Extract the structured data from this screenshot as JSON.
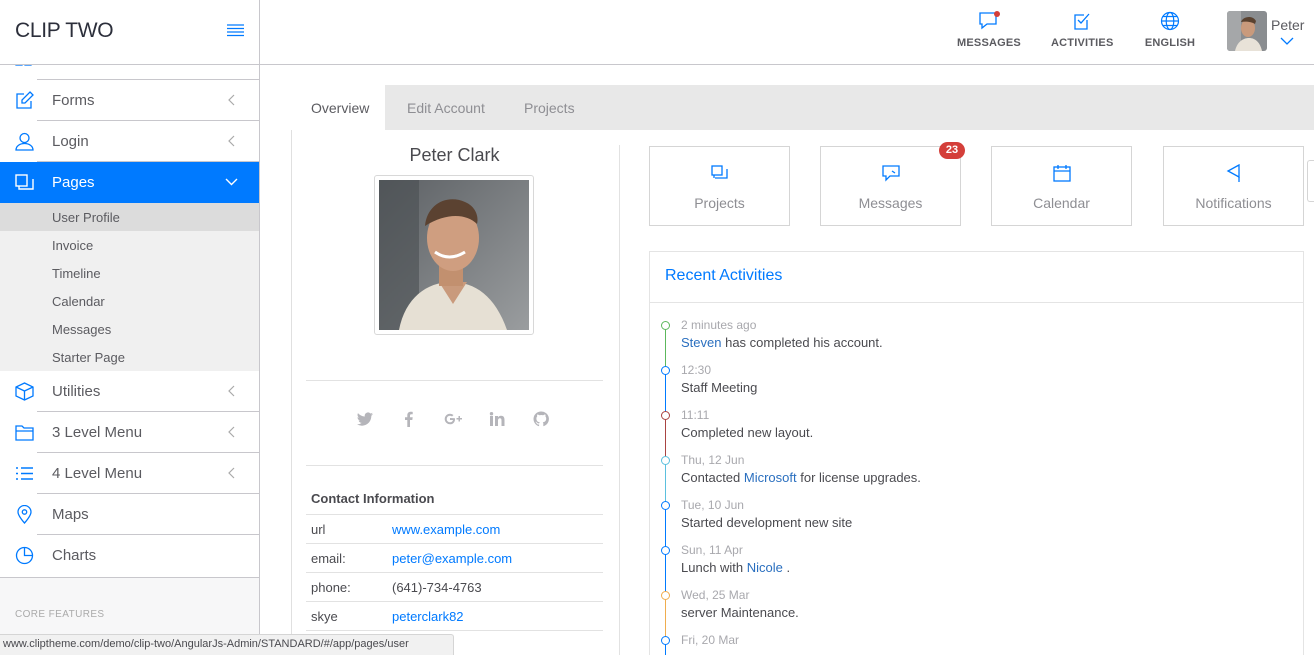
{
  "brand": {
    "name": "CLIP TWO"
  },
  "sidebar": {
    "items": [
      {
        "label": "Forms",
        "icon": "pencil-square-icon"
      },
      {
        "label": "Login",
        "icon": "user-icon"
      },
      {
        "label": "Pages",
        "icon": "copy-icon",
        "active": true
      },
      {
        "label": "Utilities",
        "icon": "cube-icon"
      },
      {
        "label": "3 Level Menu",
        "icon": "folder-icon"
      },
      {
        "label": "4 Level Menu",
        "icon": "list-icon"
      },
      {
        "label": "Maps",
        "icon": "location-pin-icon"
      },
      {
        "label": "Charts",
        "icon": "pie-chart-icon"
      }
    ],
    "submenu": [
      "User Profile",
      "Invoice",
      "Timeline",
      "Calendar",
      "Messages",
      "Starter Page"
    ],
    "section_label": "CORE FEATURES"
  },
  "topbar": {
    "messages": "MESSAGES",
    "activities": "ACTIVITIES",
    "language": "ENGLISH",
    "user": "Peter"
  },
  "tabs": [
    "Overview",
    "Edit Account",
    "Projects"
  ],
  "profile": {
    "name": "Peter Clark",
    "contact_title": "Contact Information",
    "contact": [
      {
        "key": "url",
        "value": "www.example.com",
        "link": true
      },
      {
        "key": "email:",
        "value": "peter@example.com",
        "link": true
      },
      {
        "key": "phone:",
        "value": "(641)-734-4763",
        "link": false
      },
      {
        "key": "skye",
        "value": "peterclark82",
        "link": true
      }
    ]
  },
  "quick_buttons": [
    {
      "label": "Projects",
      "icon": "projects-icon"
    },
    {
      "label": "Messages",
      "icon": "chat-icon",
      "badge": "23"
    },
    {
      "label": "Calendar",
      "icon": "calendar-icon"
    },
    {
      "label": "Notifications",
      "icon": "flag-icon"
    }
  ],
  "activities": {
    "title": "Recent Activities",
    "items": [
      {
        "time": "2 minutes ago",
        "pre": "",
        "hl": "Steven",
        "post": " has completed his account.",
        "color": "#5cb85c"
      },
      {
        "time": "12:30",
        "pre": "Staff Meeting",
        "hl": "",
        "post": "",
        "color": "#007aff"
      },
      {
        "time": "11:11",
        "pre": "Completed new layout.",
        "hl": "",
        "post": "",
        "color": "#a94442"
      },
      {
        "time": "Thu, 12 Jun",
        "pre": "Contacted ",
        "hl": "Microsoft",
        "post": " for license upgrades.",
        "color": "#5bc0de"
      },
      {
        "time": "Tue, 10 Jun",
        "pre": "Started development new site",
        "hl": "",
        "post": "",
        "color": "#007aff"
      },
      {
        "time": "Sun, 11 Apr",
        "pre": "Lunch with ",
        "hl": "Nicole",
        "post": " .",
        "color": "#007aff"
      },
      {
        "time": "Wed, 25 Mar",
        "pre": "server Maintenance.",
        "hl": "",
        "post": "",
        "color": "#f0ad4e"
      },
      {
        "time": "Fri, 20 Mar",
        "pre": "",
        "hl": "",
        "post": "",
        "color": "#007aff"
      }
    ]
  },
  "status_url": "www.cliptheme.com/demo/clip-two/AngularJs-Admin/STANDARD/#/app/pages/user",
  "colors": {
    "accent": "#007aff",
    "badge": "#d43f3a",
    "border": "#c8c7cc"
  }
}
